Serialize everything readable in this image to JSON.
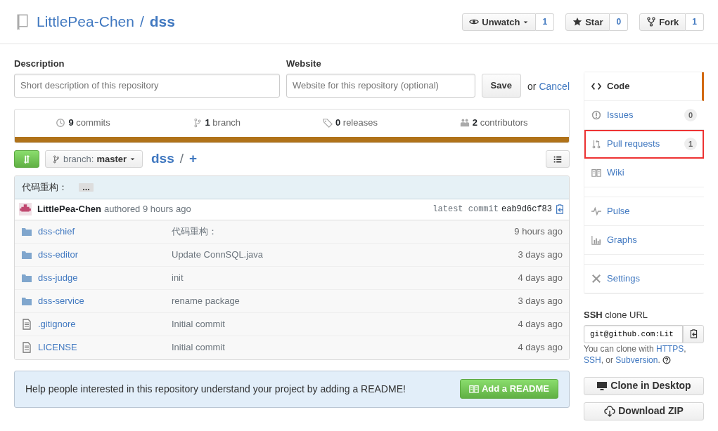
{
  "repo": {
    "owner": "LittlePea-Chen",
    "separator": "/",
    "name": "dss"
  },
  "actions": [
    {
      "kind": "watch",
      "label": "Unwatch",
      "count": "1",
      "dropdown": true
    },
    {
      "kind": "star",
      "label": "Star",
      "count": "0",
      "dropdown": false
    },
    {
      "kind": "fork",
      "label": "Fork",
      "count": "1",
      "dropdown": false
    }
  ],
  "edit_form": {
    "description_label": "Description",
    "description_placeholder": "Short description of this repository",
    "website_label": "Website",
    "website_placeholder": "Website for this repository (optional)",
    "save": "Save",
    "or": "or",
    "cancel": "Cancel"
  },
  "summary": [
    {
      "kind": "commits",
      "count": "9",
      "label": "commits"
    },
    {
      "kind": "branch",
      "count": "1",
      "label": "branch"
    },
    {
      "kind": "releases",
      "count": "0",
      "label": "releases"
    },
    {
      "kind": "contributors",
      "count": "2",
      "label": "contributors"
    }
  ],
  "file_nav": {
    "branch_label": "branch:",
    "branch": "master",
    "repo": "dss",
    "separator": "/",
    "add": "+"
  },
  "commit": {
    "message": "代码重构：",
    "ellipsis": "…",
    "author": "LittlePea-Chen",
    "authored": "authored 9 hours ago",
    "latest_label": "latest commit",
    "sha": "eab9d6cf83"
  },
  "files": [
    {
      "kind": "dir",
      "name": "dss-chief",
      "message": "代码重构：",
      "age": "9 hours ago"
    },
    {
      "kind": "dir",
      "name": "dss-editor",
      "message": "Update ConnSQL.java",
      "age": "3 days ago"
    },
    {
      "kind": "dir",
      "name": "dss-judge",
      "message": "init",
      "age": "4 days ago"
    },
    {
      "kind": "dir",
      "name": "dss-service",
      "message": "rename package",
      "age": "3 days ago"
    },
    {
      "kind": "file",
      "name": ".gitignore",
      "message": "Initial commit",
      "age": "4 days ago"
    },
    {
      "kind": "file",
      "name": "LICENSE",
      "message": "Initial commit",
      "age": "4 days ago"
    }
  ],
  "readme_notice": {
    "text": "Help people interested in this repository understand your project by adding a README!",
    "button": "Add a README"
  },
  "nav_groups": [
    {
      "items": [
        {
          "kind": "code",
          "label": "Code",
          "selected": true,
          "highlighted": false
        },
        {
          "kind": "issues",
          "label": "Issues",
          "count": "0",
          "selected": false,
          "highlighted": false
        },
        {
          "kind": "pulls",
          "label": "Pull requests",
          "count": "1",
          "selected": false,
          "highlighted": true
        },
        {
          "kind": "wiki",
          "label": "Wiki",
          "selected": false,
          "highlighted": false
        }
      ]
    },
    {
      "items": [
        {
          "kind": "pulse",
          "label": "Pulse",
          "selected": false,
          "highlighted": false
        },
        {
          "kind": "graphs",
          "label": "Graphs",
          "selected": false,
          "highlighted": false
        }
      ]
    },
    {
      "items": [
        {
          "kind": "settings",
          "label": "Settings",
          "selected": false,
          "highlighted": false
        }
      ]
    }
  ],
  "clone": {
    "protocol": "SSH",
    "label": "clone URL",
    "url": "git@github.com:Lit",
    "help": [
      {
        "kind": "text",
        "text": "You can clone with "
      },
      {
        "kind": "link",
        "text": "HTTPS"
      },
      {
        "kind": "text",
        "text": ", "
      },
      {
        "kind": "link",
        "text": "SSH"
      },
      {
        "kind": "text",
        "text": ", or "
      },
      {
        "kind": "link",
        "text": "Subversion"
      },
      {
        "kind": "text",
        "text": "."
      }
    ],
    "buttons": [
      {
        "kind": "desktop",
        "label": "Clone in Desktop"
      },
      {
        "kind": "zip",
        "label": "Download ZIP"
      }
    ]
  }
}
